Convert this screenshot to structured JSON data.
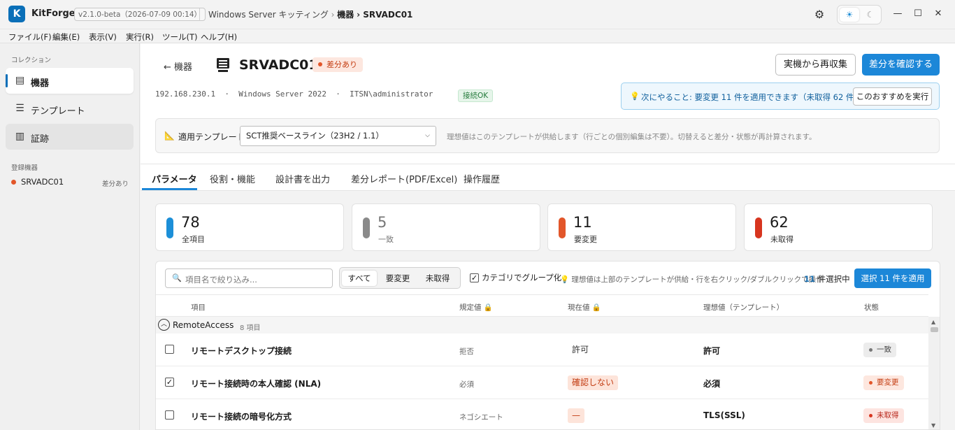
{
  "app": {
    "logo_letter": "K",
    "name": "KitForge",
    "version": "v2.1.0-beta（2026-07-09 00:14）",
    "breadcrumb_prefix": "Windows Server キッティング",
    "breadcrumb_sep": "›",
    "breadcrumb_section": "機器",
    "breadcrumb_sep2": "›",
    "breadcrumb_current": "SRVADC01"
  },
  "menu": [
    "ファイル(F)",
    "編集(E)",
    "表示(V)",
    "実行(R)",
    "ツール(T)",
    "ヘルプ(H)"
  ],
  "sidebar": {
    "collection_heading": "コレクション",
    "items": [
      {
        "label": "機器",
        "icon": "server-icon",
        "state": "active"
      },
      {
        "label": "テンプレート",
        "icon": "document-icon",
        "state": "normal"
      },
      {
        "label": "証跡",
        "icon": "chart-icon",
        "state": "hover"
      }
    ],
    "devices_heading": "登録機器",
    "devices": [
      {
        "name": "SRVADC01",
        "status": "差分あり"
      }
    ]
  },
  "header": {
    "back": "← 機器",
    "title": "SRVADC01",
    "badge": "差分あり",
    "recollect_button": "実機から再収集",
    "confirm_button": "差分を確認する",
    "meta": "192.168.230.1  ·  Windows Server 2022  ·  ITSN\\administrator",
    "connection": "接続OK",
    "next_step": "次にやること: 要変更 11 件を適用できます（未取得 62 件）",
    "run_recommendation": "このおすすめを実行"
  },
  "template_bar": {
    "label": "適用テンプレート",
    "selected": "SCT推奨ベースライン（23H2 / 1.1）",
    "note": "理想値はこのテンプレートが供給します（行ごとの個別編集は不要）。切替えると差分・状態が再計算されます。"
  },
  "tabs": [
    "パラメータ",
    "役割・機能",
    "設計書を出力",
    "差分レポート(PDF/Excel)",
    "操作履歴"
  ],
  "stats": [
    {
      "value": "78",
      "label": "全項目",
      "color": "#1c8fd8"
    },
    {
      "value": "5",
      "label": "一致",
      "color": "#8a8a8a"
    },
    {
      "value": "11",
      "label": "要変更",
      "color": "#e2562a"
    },
    {
      "value": "62",
      "label": "未取得",
      "color": "#d7351f"
    }
  ],
  "toolbar": {
    "search_placeholder": "項目名で絞り込み...",
    "filters": [
      "すべて",
      "要変更",
      "未取得"
    ],
    "group_by_category": "カテゴリでグループ化",
    "hint": "理想値は上部のテンプレートが供給・行を右クリック/ダブルクリックで操作",
    "selected_count": "11",
    "selected_suffix": " 件選択中",
    "apply_button": "選択 11 件を適用"
  },
  "table": {
    "headers": [
      "項目",
      "規定値",
      "現在値",
      "理想値（テンプレート）",
      "状態"
    ],
    "group": {
      "name": "RemoteAccess",
      "count": "8 項目"
    },
    "rows": [
      {
        "checked": false,
        "name": "リモートデスクトップ接続",
        "default": "拒否",
        "current": "許可",
        "ideal": "許可",
        "status": "一致",
        "status_type": "match"
      },
      {
        "checked": true,
        "name": "リモート接続時の本人確認 (NLA)",
        "default": "必須",
        "current": "確認しない",
        "ideal": "必須",
        "status": "要変更",
        "status_type": "change"
      },
      {
        "checked": false,
        "name": "リモート接続の暗号化方式",
        "default": "ネゴシエート",
        "current": "—",
        "ideal": "TLS(SSL)",
        "status": "未取得",
        "status_type": "missing"
      }
    ]
  }
}
